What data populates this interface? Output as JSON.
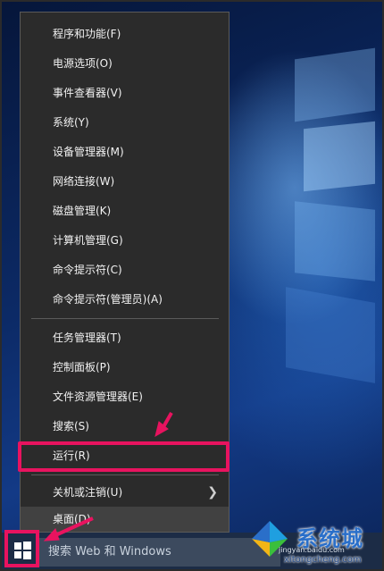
{
  "menu": {
    "group1": [
      {
        "label": "程序和功能(F)"
      },
      {
        "label": "电源选项(O)"
      },
      {
        "label": "事件查看器(V)"
      },
      {
        "label": "系统(Y)"
      },
      {
        "label": "设备管理器(M)"
      },
      {
        "label": "网络连接(W)"
      },
      {
        "label": "磁盘管理(K)"
      },
      {
        "label": "计算机管理(G)"
      },
      {
        "label": "命令提示符(C)"
      },
      {
        "label": "命令提示符(管理员)(A)"
      }
    ],
    "group2": [
      {
        "label": "任务管理器(T)"
      },
      {
        "label": "控制面板(P)"
      },
      {
        "label": "文件资源管理器(E)"
      },
      {
        "label": "搜索(S)"
      },
      {
        "label": "运行(R)"
      }
    ],
    "group3": [
      {
        "label": "关机或注销(U)",
        "submenu_icon": "chevron-right-icon"
      },
      {
        "label": "桌面(D)"
      }
    ]
  },
  "taskbar": {
    "search_placeholder": "搜索 Web 和 Windows",
    "start_icon": "windows-logo-icon"
  },
  "watermark": {
    "text": "系统城",
    "url": "xitongcheng.com",
    "baidu": "jingyan.baidu.com"
  },
  "annotation_color": "#e8135f"
}
